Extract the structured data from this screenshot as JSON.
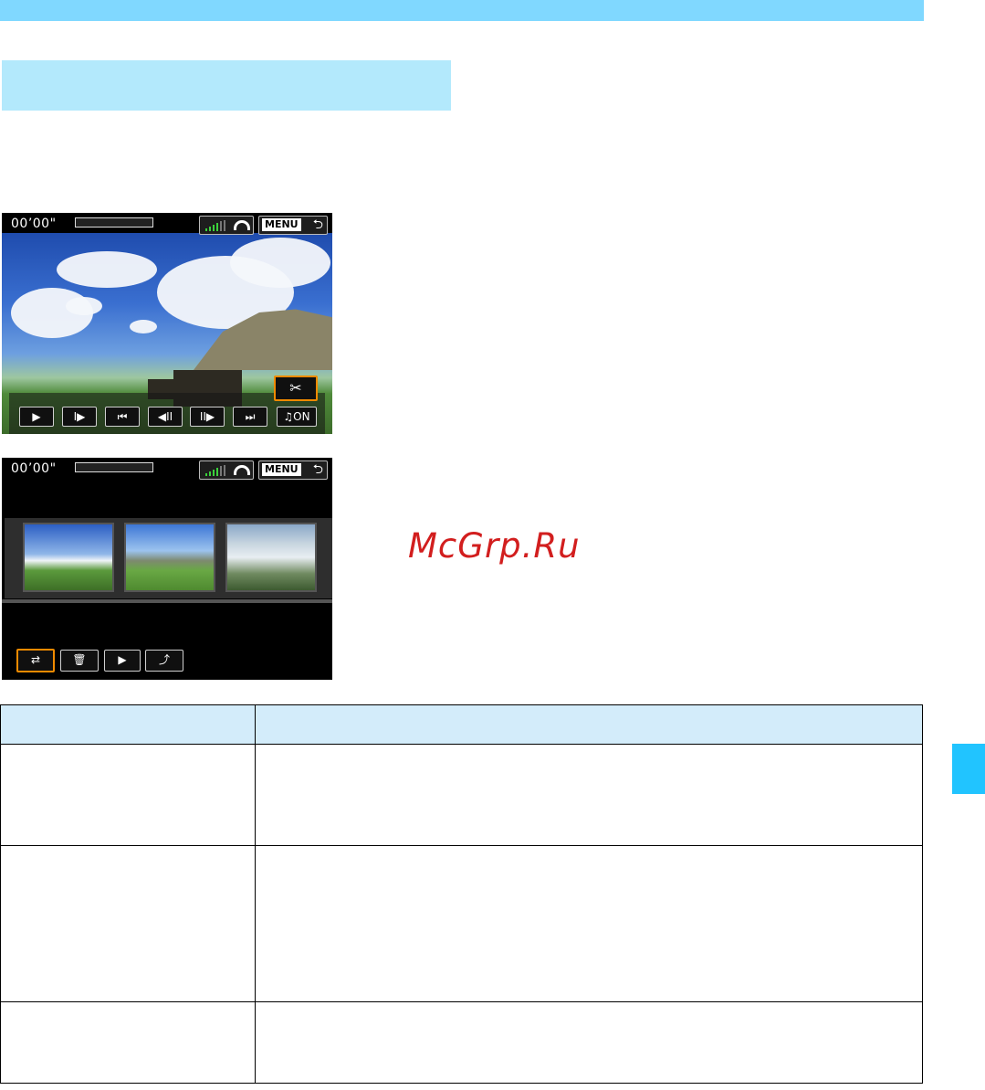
{
  "watermark": "McGrp.Ru",
  "screen_top": {
    "timecode": "00’00\"",
    "menu_label": "MENU",
    "return_symbol": "⮌",
    "cut_symbol": "✂",
    "controls": [
      "▶",
      "I▶",
      "⏮",
      "◀II",
      "II▶",
      "⏭",
      "♫ON"
    ]
  },
  "screen_bottom": {
    "timecode": "00’00\"",
    "menu_label": "MENU",
    "return_symbol": "⮌",
    "buttons": [
      "⇄",
      "🗑",
      "▶",
      "⤴"
    ]
  },
  "colors": {
    "top_bar": "#80d8ff",
    "heading_box": "#b3e9fc",
    "side_tab": "#21c4ff",
    "table_header": "#d3ecfa",
    "selected_border": "#f08a00"
  }
}
